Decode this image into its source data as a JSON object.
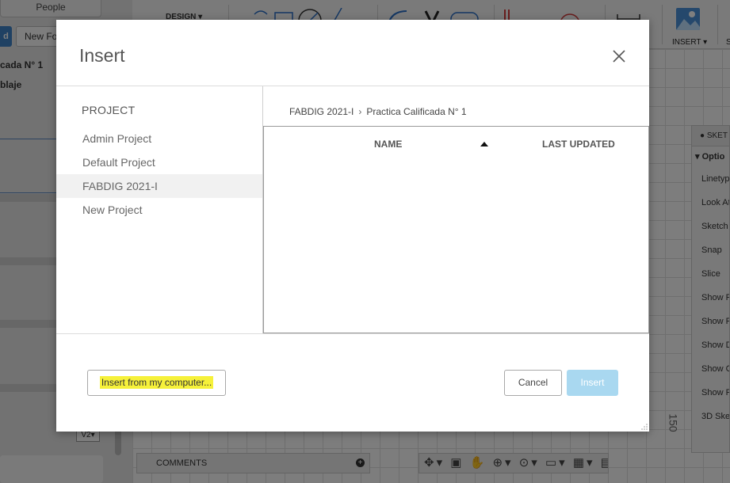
{
  "background": {
    "people_label": "People",
    "new_folder_label": "New Fo",
    "tree_item_1": "cada N° 1",
    "tree_item_2": "blaje",
    "version_badge": "V2",
    "design_menu": "DESIGN",
    "insert_menu": "INSERT",
    "s_menu": "S",
    "sketch_palette": {
      "header": "SKET",
      "options_label": "Optio",
      "rows": [
        "Linetyp",
        "Look At",
        "Sketch",
        "Snap",
        "Slice",
        "Show P",
        "Show P",
        "Show D",
        "Show C",
        "Show P",
        "3D Sket"
      ]
    },
    "comments_label": "COMMENTS",
    "ruler_value": "150"
  },
  "dialog": {
    "title": "Insert",
    "project_header": "PROJECT",
    "projects": [
      {
        "label": "Admin Project",
        "selected": false
      },
      {
        "label": "Default Project",
        "selected": false
      },
      {
        "label": "FABDIG 2021-I",
        "selected": true
      },
      {
        "label": "New Project",
        "selected": false
      }
    ],
    "breadcrumb": {
      "parent": "FABDIG 2021-I",
      "separator": "›",
      "current": "Practica Calificada N° 1"
    },
    "table": {
      "col_name": "NAME",
      "col_updated": "LAST UPDATED",
      "rows": []
    },
    "buttons": {
      "insert_from_computer": "Insert from my computer...",
      "cancel": "Cancel",
      "insert": "Insert"
    }
  },
  "colors": {
    "highlight": "#f6f13a",
    "insert_disabled": "#a9d8f0",
    "accent": "#3f83c7"
  }
}
